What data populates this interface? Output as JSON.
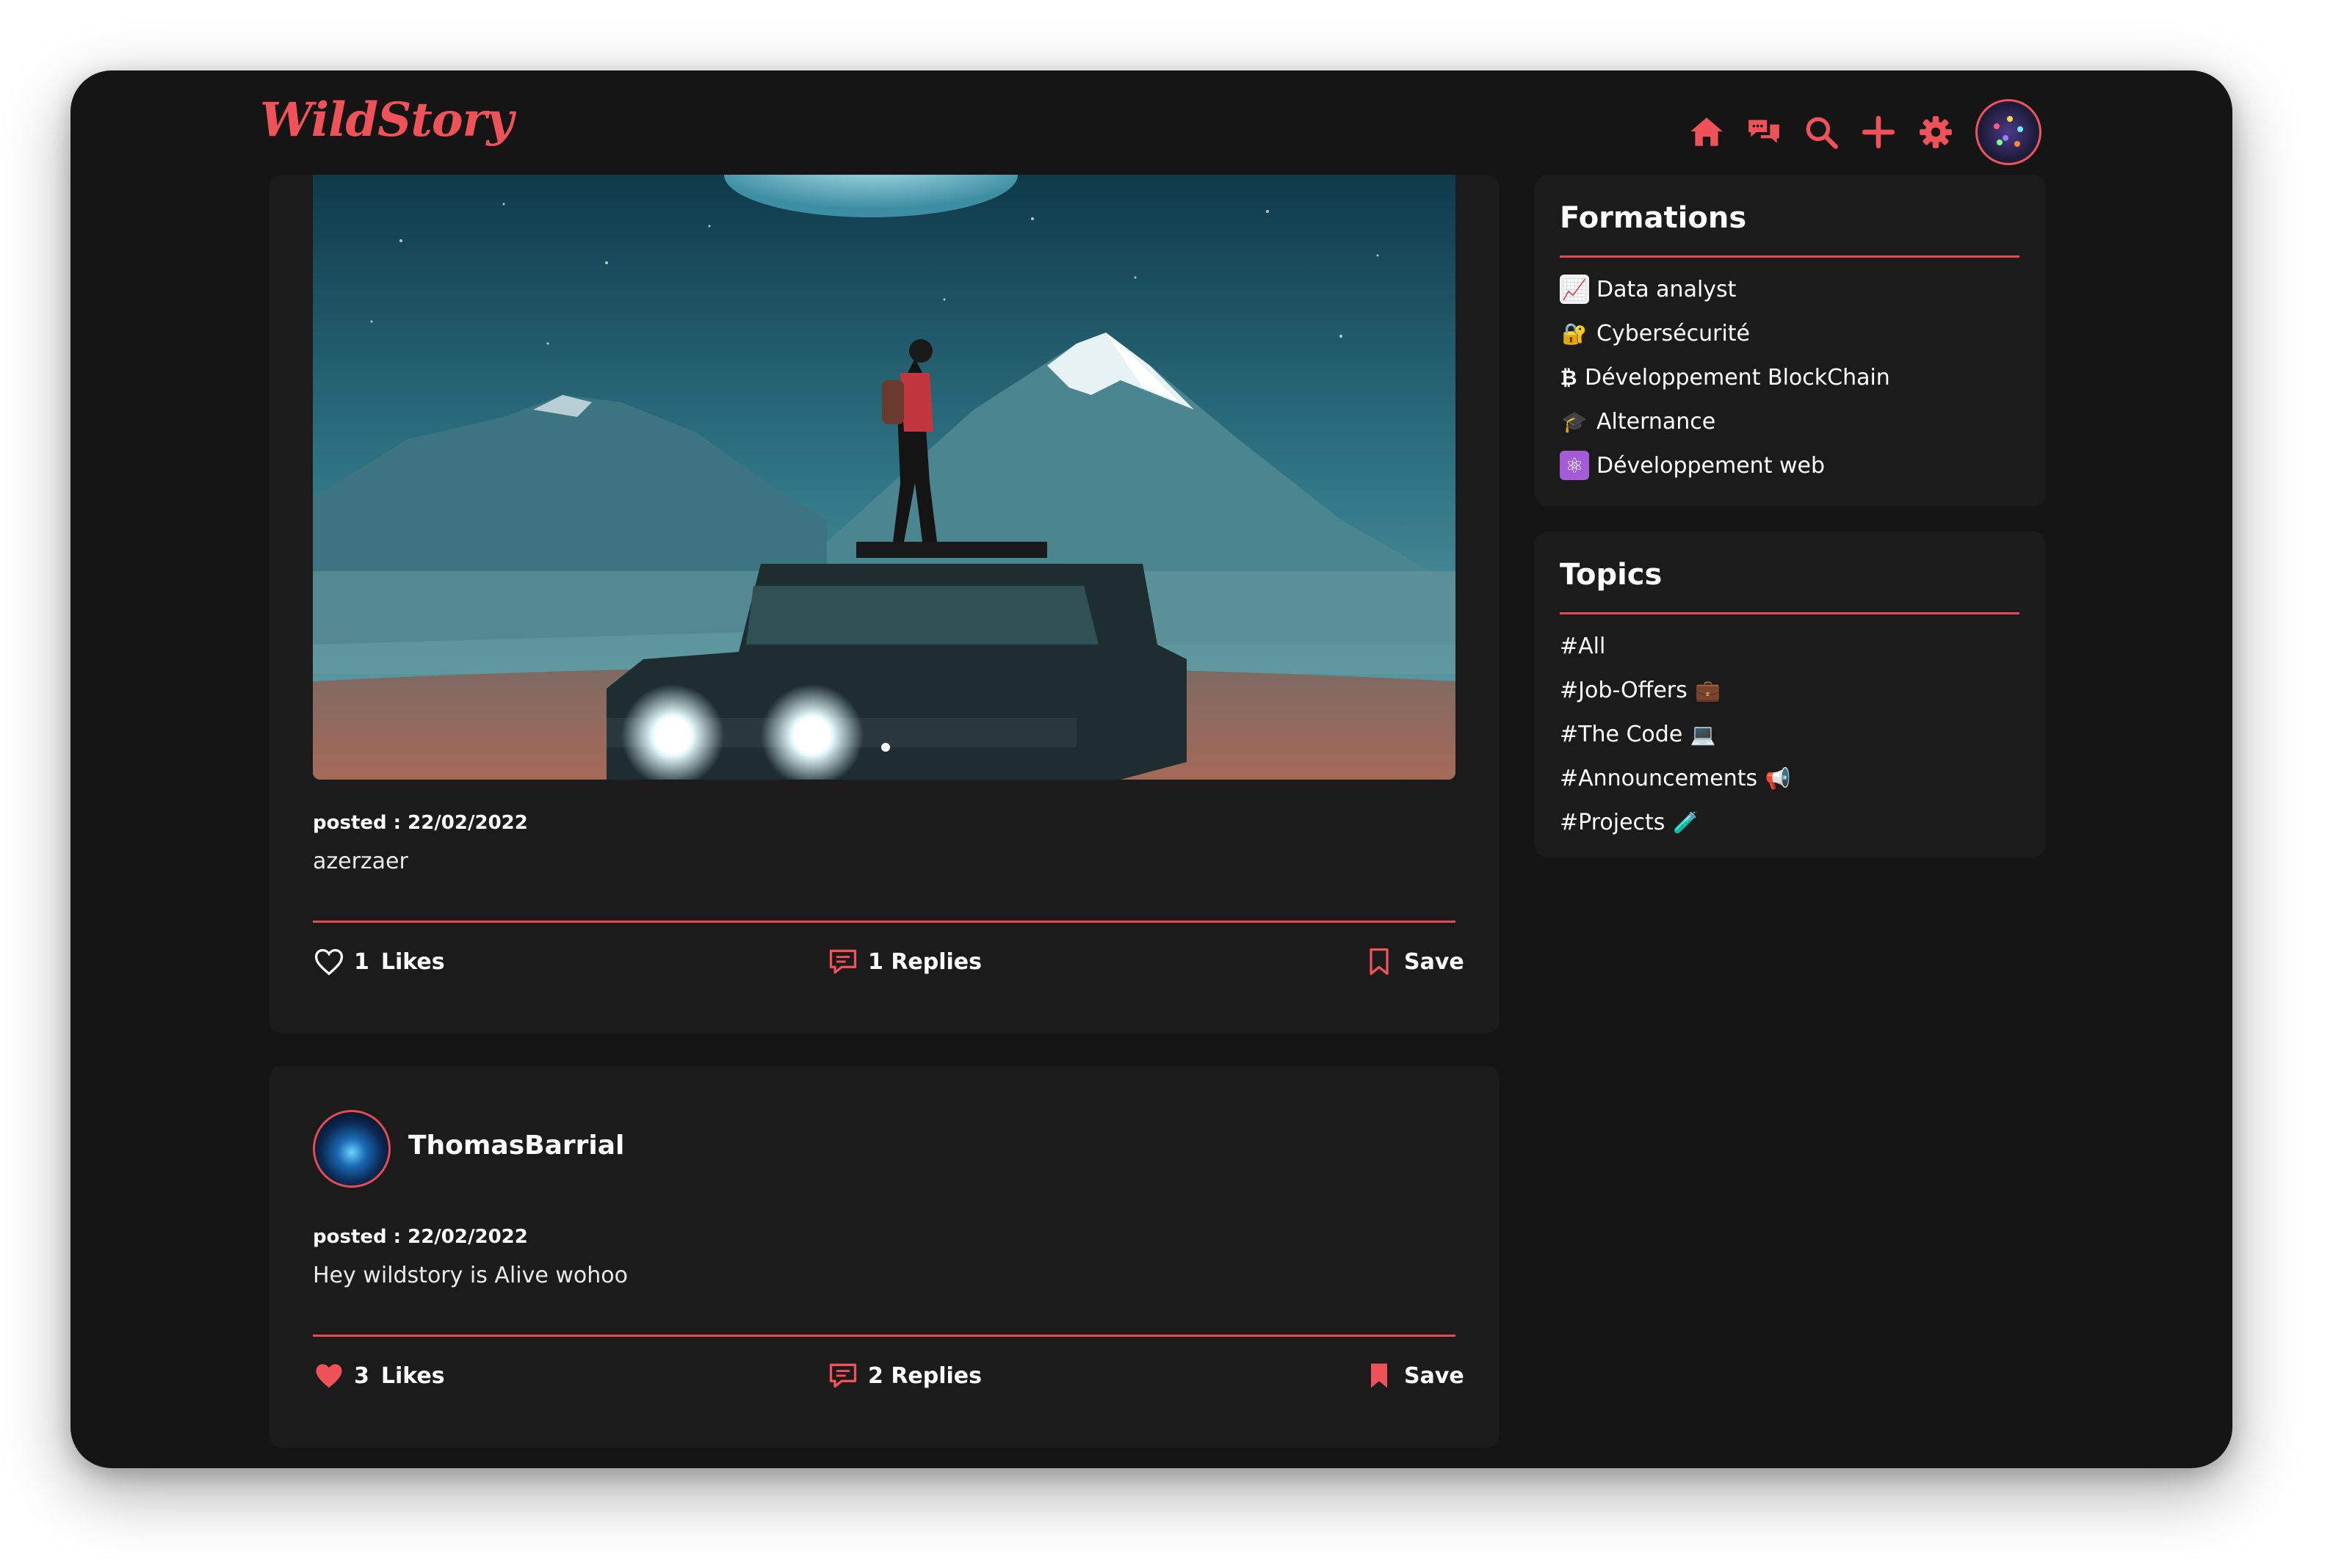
{
  "app": {
    "logo": "WildStory"
  },
  "nav": {
    "items": [
      {
        "icon": "home-icon"
      },
      {
        "icon": "chat-icon"
      },
      {
        "icon": "search-icon"
      },
      {
        "icon": "plus-icon"
      },
      {
        "icon": "gear-icon"
      },
      {
        "icon": "avatar"
      }
    ]
  },
  "posts": [
    {
      "posted": "posted : 22/02/2022",
      "content": "azerzaer",
      "likes_count": "1",
      "likes_label": "Likes",
      "liked": false,
      "replies_label": "1 Replies",
      "save_label": "Save",
      "saved": false
    },
    {
      "author": "ThomasBarrial",
      "posted": "posted : 22/02/2022",
      "content": "Hey wildstory is Alive wohoo",
      "likes_count": "3",
      "likes_label": "Likes",
      "liked": true,
      "replies_label": "2 Replies",
      "save_label": "Save",
      "saved": true
    }
  ],
  "formations": {
    "title": "Formations",
    "items": [
      {
        "emoji": "📈",
        "label": "Data analyst"
      },
      {
        "emoji": "🔐",
        "label": "Cybersécurité"
      },
      {
        "emoji": "₿",
        "label": "Développement BlockChain"
      },
      {
        "emoji": "🎓",
        "label": "Alternance"
      },
      {
        "emoji": "⚛",
        "label": "Développement web"
      }
    ]
  },
  "topics": {
    "title": "Topics",
    "items": [
      {
        "label": "#All",
        "emoji": ""
      },
      {
        "label": "#Job-Offers",
        "emoji": "💼"
      },
      {
        "label": "#The Code",
        "emoji": "💻"
      },
      {
        "label": "#Announcements",
        "emoji": "📢"
      },
      {
        "label": "#Projects",
        "emoji": "🧪"
      }
    ]
  },
  "colors": {
    "accent": "#f0525a",
    "background": "#151515",
    "card": "#1b1b1b"
  }
}
